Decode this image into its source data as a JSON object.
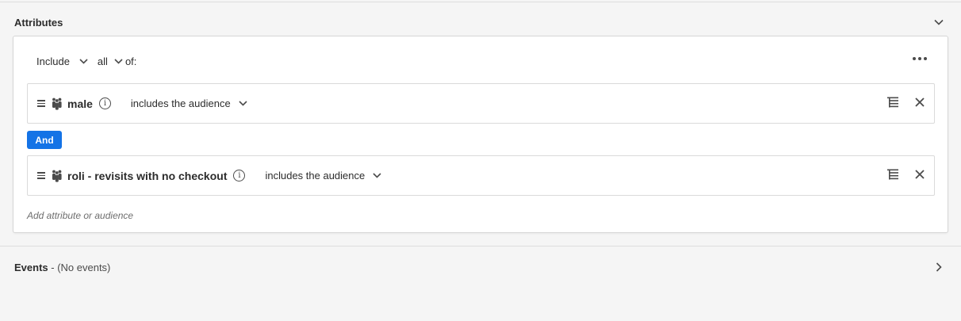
{
  "attributes": {
    "title": "Attributes",
    "toggle_icon": "chevron-down-icon"
  },
  "rule": {
    "include_label": "Include",
    "all_label": "all",
    "of_label": "of:",
    "more_icon": "more-icon"
  },
  "conditions": [
    {
      "name": "male",
      "operator": "includes the audience"
    },
    {
      "name": "roli - revisits with no checkout",
      "operator": "includes the audience"
    }
  ],
  "and_label": "And",
  "add_label": "Add attribute or audience",
  "events": {
    "title": "Events",
    "subtitle": " - (No events)",
    "toggle_icon": "chevron-right-icon"
  },
  "colors": {
    "accent": "#1473e6",
    "background": "#f5f5f5",
    "panel": "#ffffff"
  }
}
